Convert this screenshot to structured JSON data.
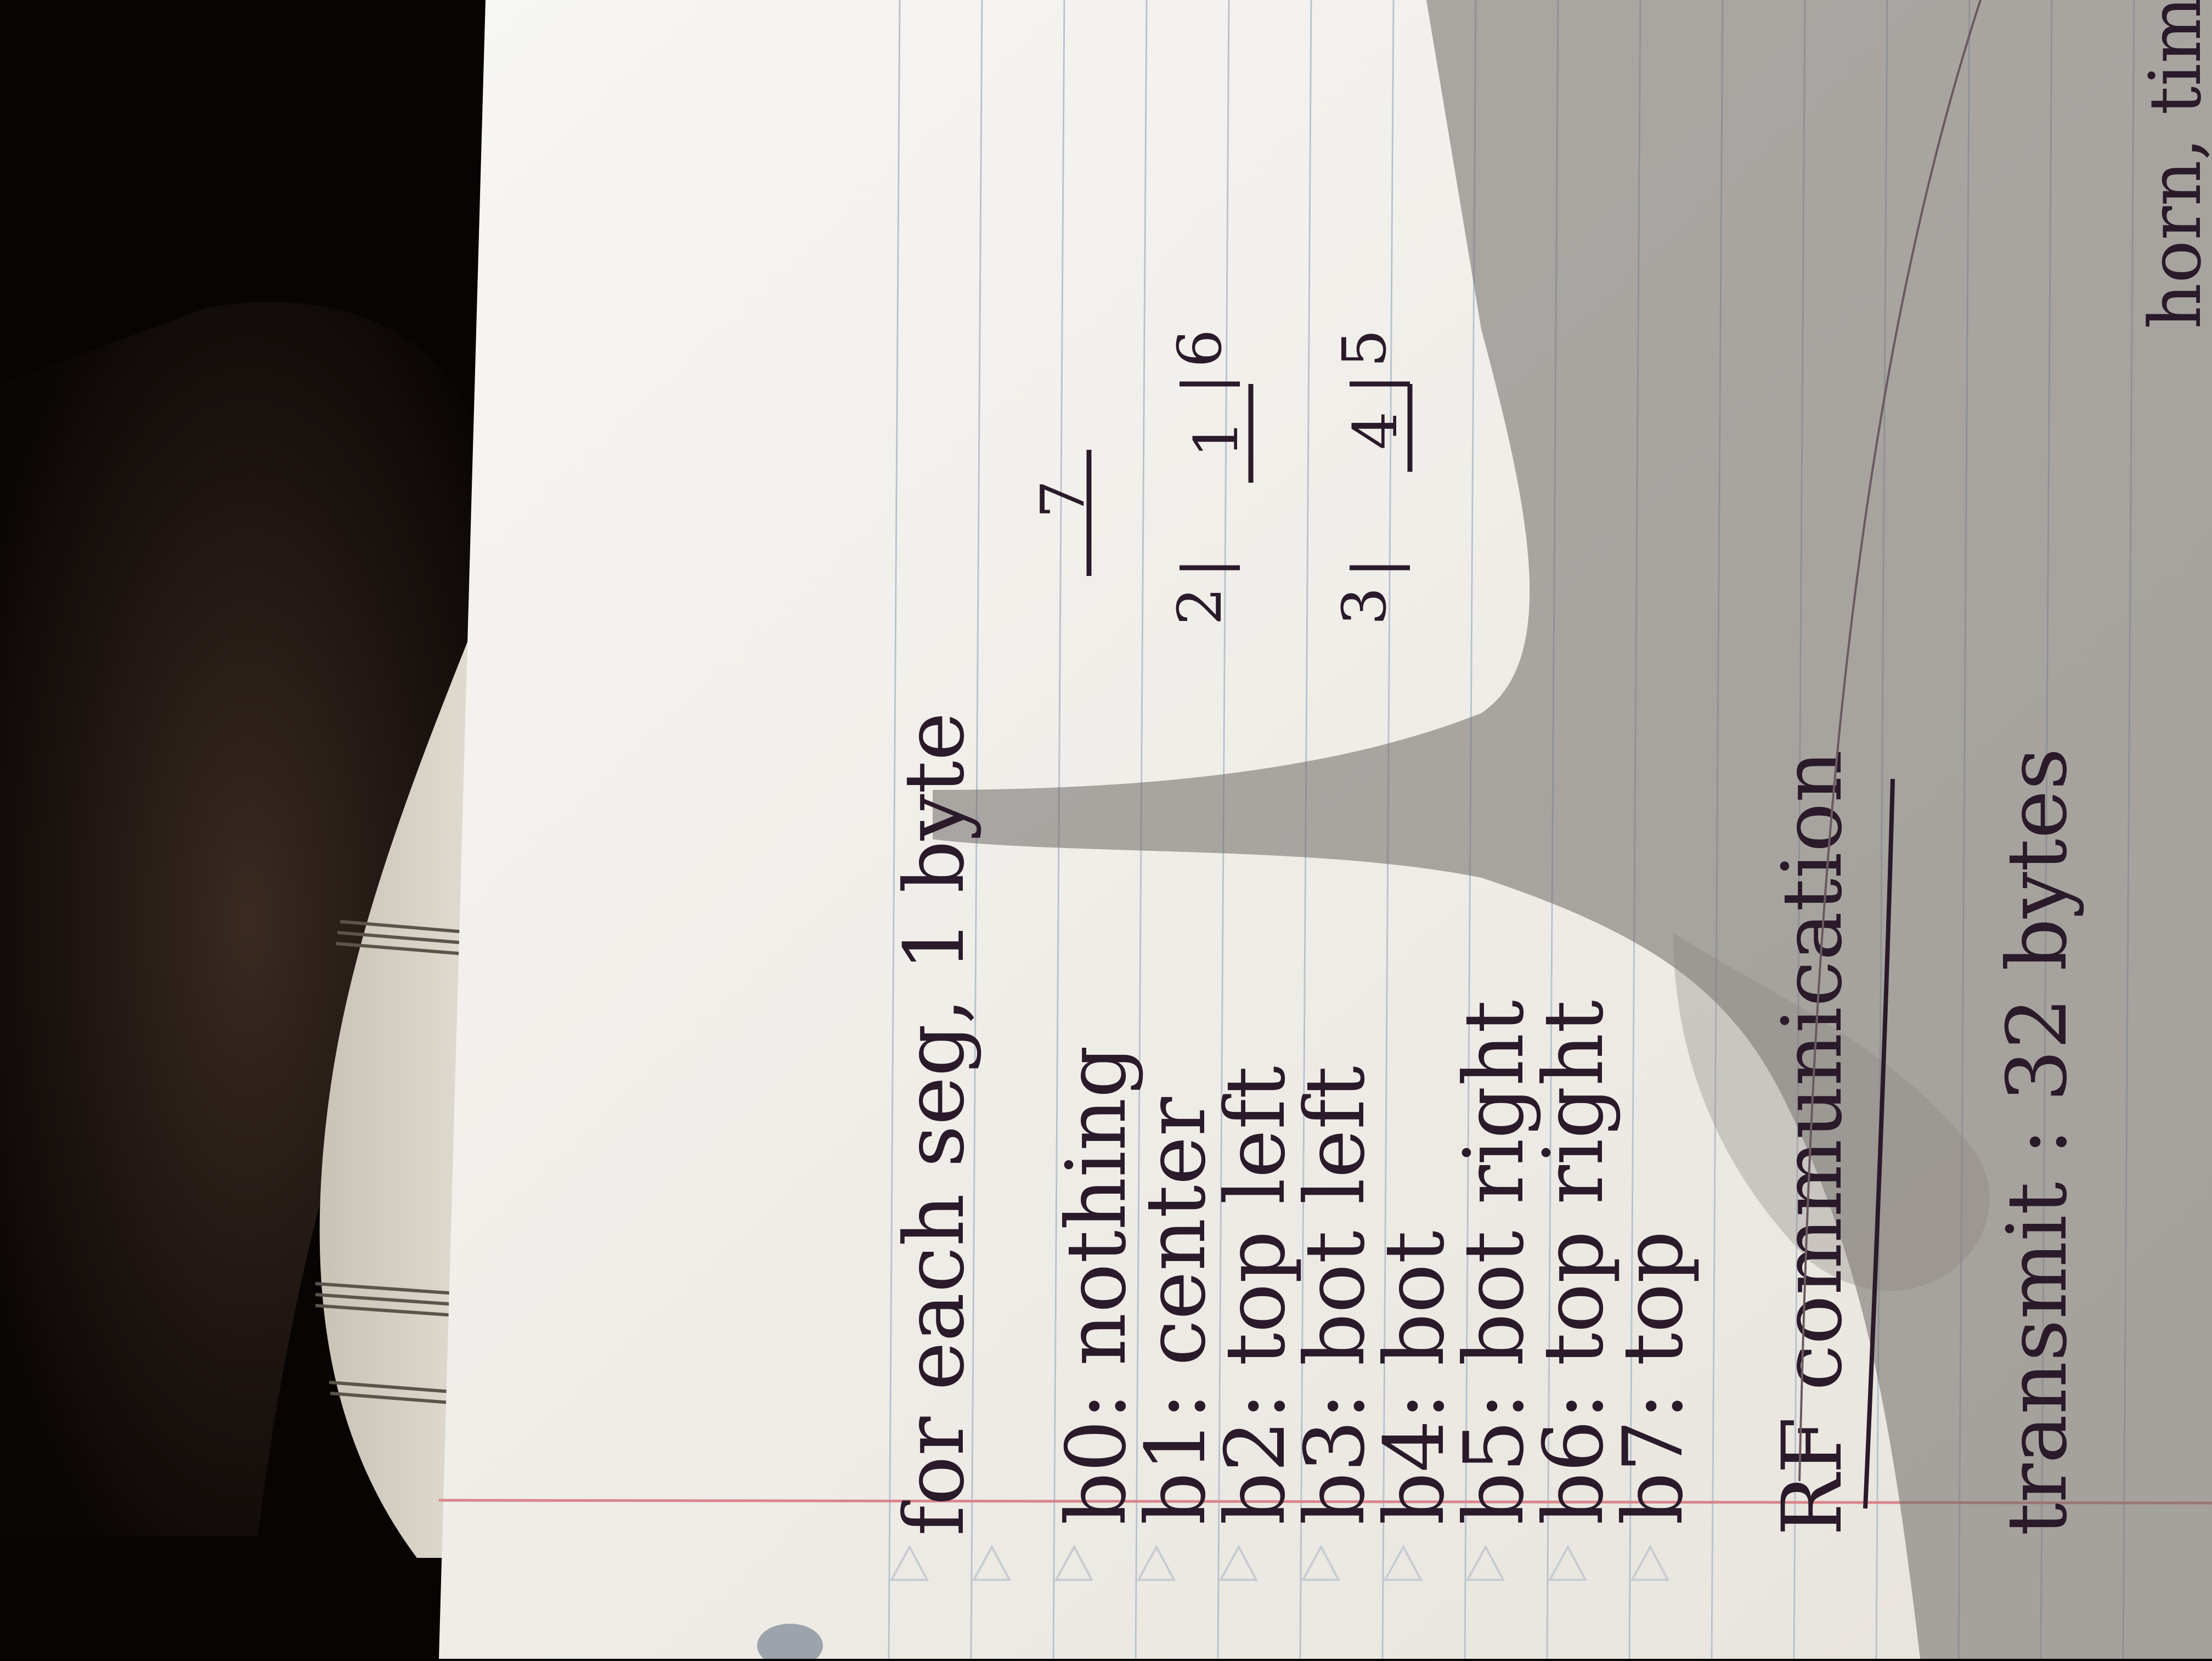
{
  "note": {
    "heading": "for each seg, 1 byte",
    "bits": [
      {
        "label": "b0:",
        "text": "nothing"
      },
      {
        "label": "b1:",
        "text": "center"
      },
      {
        "label": "b2:",
        "text": "top left"
      },
      {
        "label": "b3:",
        "text": "bot left"
      },
      {
        "label": "b4:",
        "text": "bot"
      },
      {
        "label": "b5:",
        "text": "bot right"
      },
      {
        "label": "b6:",
        "text": "top right"
      },
      {
        "label": "b7:",
        "text": "top"
      }
    ],
    "diagram": {
      "top_bar": "7",
      "row1_left": "2",
      "row1_mid": "1",
      "row1_right": "6",
      "row2_left": "3",
      "row2_mid": "4",
      "row2_right": "5"
    },
    "section_title": "RF communication",
    "footer_line_1": "transmit : 32 bytes",
    "footer_line_2": "horn, time,"
  },
  "colors": {
    "ink": "#2a1a2a",
    "paper": "#f4f2ee",
    "rule": "#b9c3cf",
    "margin": "#d9868c",
    "shadow": "#6e6a66"
  }
}
